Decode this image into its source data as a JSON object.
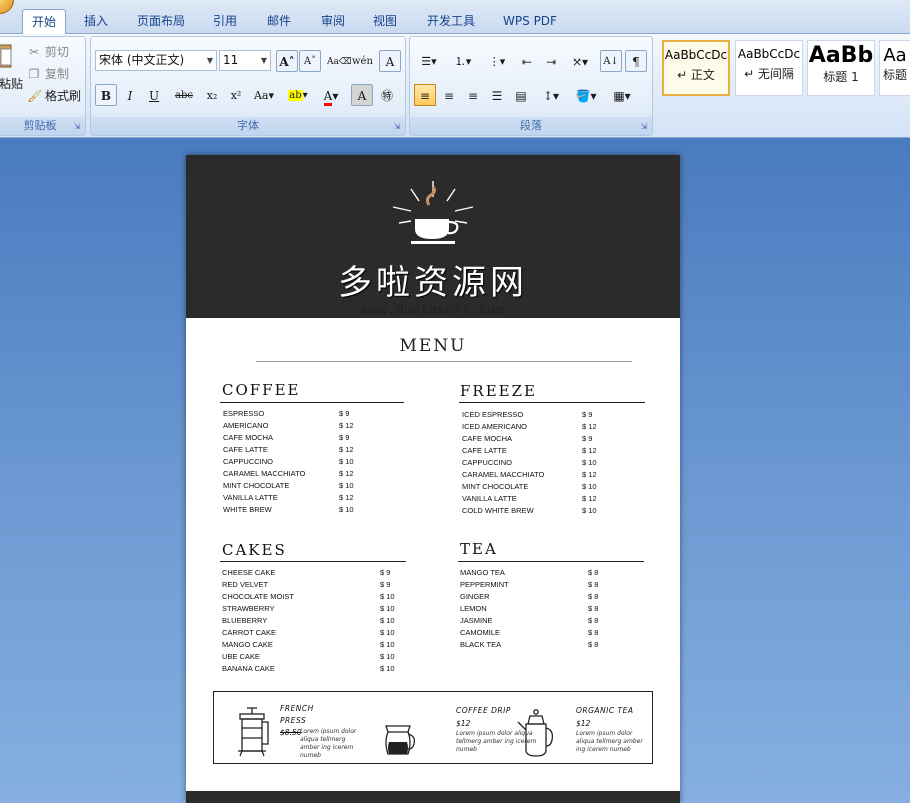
{
  "ribbon": {
    "tabs": [
      "开始",
      "插入",
      "页面布局",
      "引用",
      "邮件",
      "审阅",
      "视图",
      "开发工具",
      "WPS PDF"
    ],
    "clipboard": {
      "paste_label": "粘贴",
      "cut_label": "剪切",
      "copy_label": "复制",
      "format_painter_label": "格式刷",
      "group_label": "剪贴板"
    },
    "font": {
      "font_name": "宋体 (中文正文)",
      "font_size": "11",
      "group_label": "字体"
    },
    "paragraph": {
      "group_label": "段落"
    },
    "styles": [
      {
        "sample": "AaBbCcDc",
        "label": "↵ 正文"
      },
      {
        "sample": "AaBbCcDc",
        "label": "↵ 无间隔"
      },
      {
        "sample": "AaBb",
        "label": "标题 1"
      },
      {
        "sample": "Aa",
        "label": "标题"
      }
    ],
    "accent_colors": {
      "highlight": "#ffff00",
      "font_color": "#ff0000"
    }
  },
  "document": {
    "watermark_cn": "多啦资源网",
    "watermark_url": "www.duolasoft.com",
    "menu_title": "MENU",
    "sections": {
      "coffee": {
        "title": "COFFEE",
        "items": [
          {
            "name": "ESPRESSO",
            "price": "$ 9"
          },
          {
            "name": "AMERICANO",
            "price": "$ 12"
          },
          {
            "name": "CAFE MOCHA",
            "price": "$ 9"
          },
          {
            "name": "CAFE LATTE",
            "price": "$ 12"
          },
          {
            "name": "CAPPUCCINO",
            "price": "$ 10"
          },
          {
            "name": "CARAMEL MACCHIATO",
            "price": "$ 12"
          },
          {
            "name": "MINT CHOCOLATE",
            "price": "$ 10"
          },
          {
            "name": "VANILLA LATTE",
            "price": "$ 12"
          },
          {
            "name": "WHITE BREW",
            "price": "$ 10"
          }
        ]
      },
      "freeze": {
        "title": "FREEZE",
        "items": [
          {
            "name": "ICED ESPRESSO",
            "price": "$ 9"
          },
          {
            "name": "ICED AMERICANO",
            "price": "$ 12"
          },
          {
            "name": "CAFE MOCHA",
            "price": "$ 9"
          },
          {
            "name": "CAFE LATTE",
            "price": "$ 12"
          },
          {
            "name": "CAPPUCCINO",
            "price": "$ 10"
          },
          {
            "name": "CARAMEL MACCHIATO",
            "price": "$ 12"
          },
          {
            "name": "MINT CHOCOLATE",
            "price": "$ 10"
          },
          {
            "name": "VANILLA LATTE",
            "price": "$ 12"
          },
          {
            "name": "COLD WHITE BREW",
            "price": "$ 10"
          }
        ]
      },
      "cakes": {
        "title": "CAKES",
        "items": [
          {
            "name": "CHEESE CAKE",
            "price": "$ 9"
          },
          {
            "name": "RED VELVET",
            "price": "$ 9"
          },
          {
            "name": "CHOCOLATE MOIST",
            "price": "$ 10"
          },
          {
            "name": "STRAWBERRY",
            "price": "$ 10"
          },
          {
            "name": "BLUEBERRY",
            "price": "$ 10"
          },
          {
            "name": "CARROT CAKE",
            "price": "$ 10"
          },
          {
            "name": "MANGO CAKE",
            "price": "$ 10"
          },
          {
            "name": "UBE CAKE",
            "price": "$ 10"
          },
          {
            "name": "BANANA CAKE",
            "price": "$ 10"
          }
        ]
      },
      "tea": {
        "title": "TEA",
        "items": [
          {
            "name": "MANGO TEA",
            "price": "$ 8"
          },
          {
            "name": "PEPPERMINT",
            "price": "$ 8"
          },
          {
            "name": "GINGER",
            "price": "$ 8"
          },
          {
            "name": "LEMON",
            "price": "$ 8"
          },
          {
            "name": "JASMINE",
            "price": "$ 8"
          },
          {
            "name": "CAMOMILE",
            "price": "$ 8"
          },
          {
            "name": "BLACK TEA",
            "price": "$ 8"
          }
        ]
      }
    },
    "featured": [
      {
        "name_line1": "FRENCH",
        "name_line2": "PRESS",
        "price": "$8.50",
        "desc": "Lorem ipsum dolor aliqua tellmerg amber ing icerem numeb"
      },
      {
        "name_line1": "COFFEE DRIP",
        "name_line2": "",
        "price": "$12",
        "desc": "Lorem ipsum dolor aliqua tellmerg amber ing icerem numeb"
      },
      {
        "name_line1": "ORGANIC TEA",
        "name_line2": "",
        "price": "$12",
        "desc": "Lorem ipsum dolor aliqua tellmerg amber ing icerem numeb"
      }
    ]
  }
}
